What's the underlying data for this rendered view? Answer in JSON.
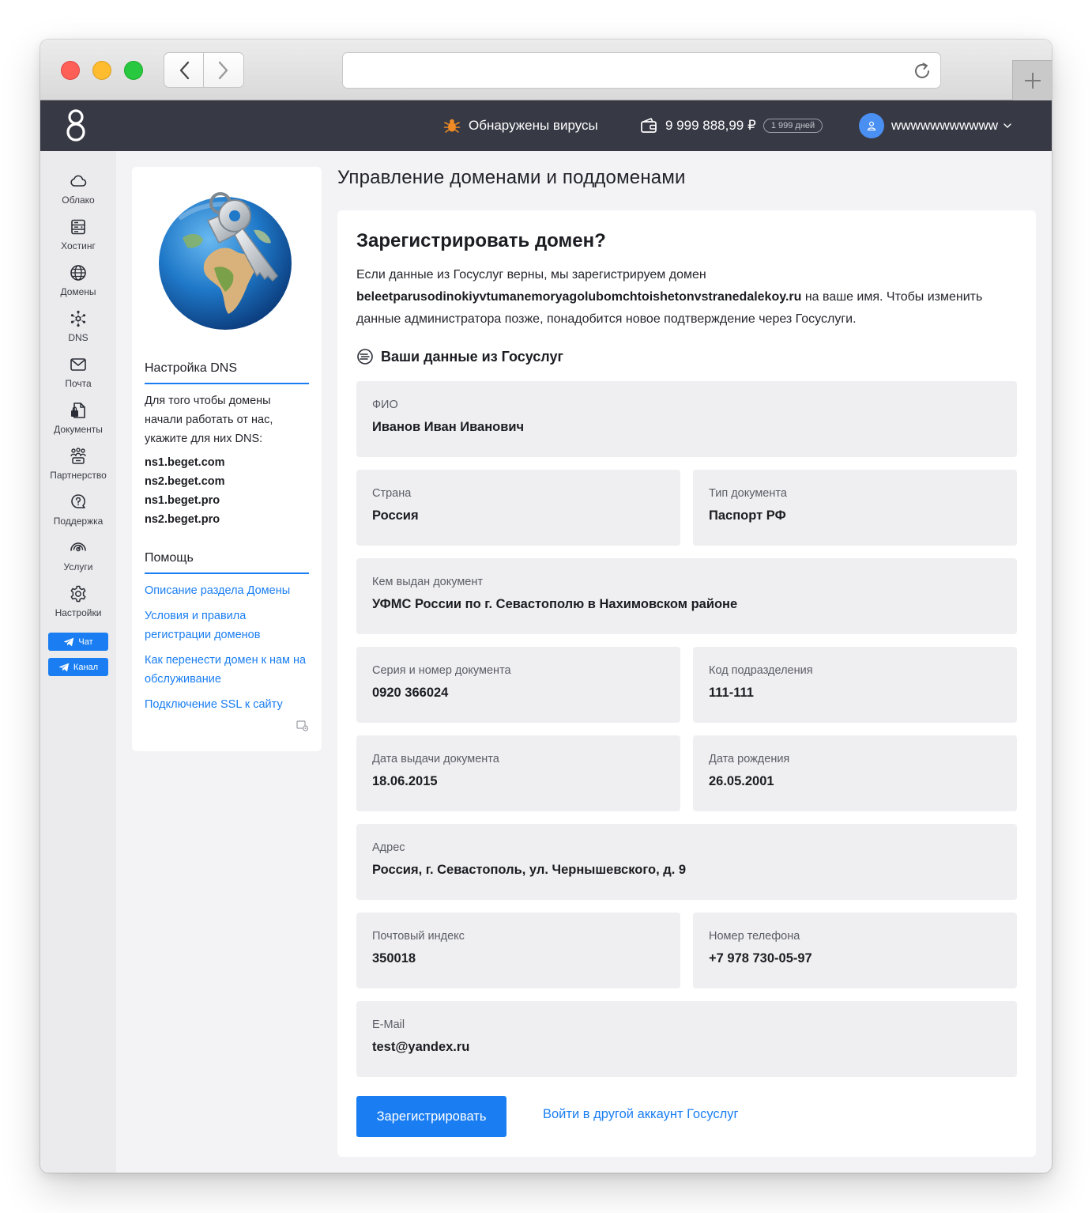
{
  "header": {
    "virus_text": "Обнаружены вирусы",
    "balance": "9 999 888,99 ₽",
    "days": "1 999 дней",
    "username": "wwwwwwwwwww"
  },
  "nav": {
    "items": [
      {
        "label": "Облако",
        "icon": "cloud-icon"
      },
      {
        "label": "Хостинг",
        "icon": "server-icon"
      },
      {
        "label": "Домены",
        "icon": "globe-icon"
      },
      {
        "label": "DNS",
        "icon": "dns-network-icon"
      },
      {
        "label": "Почта",
        "icon": "mail-icon"
      },
      {
        "label": "Документы",
        "icon": "documents-icon"
      },
      {
        "label": "Партнерство",
        "icon": "partners-icon"
      },
      {
        "label": "Поддержка",
        "icon": "support-icon"
      },
      {
        "label": "Услуги",
        "icon": "services-icon"
      },
      {
        "label": "Настройки",
        "icon": "gear-icon"
      }
    ],
    "chat_label": "Чат",
    "channel_label": "Канал"
  },
  "sidebar": {
    "dns_heading": "Настройка DNS",
    "dns_text": "Для того чтобы домены начали работать от нас, укажите для них DNS:",
    "nameservers": [
      "ns1.beget.com",
      "ns2.beget.com",
      "ns1.beget.pro",
      "ns2.beget.pro"
    ],
    "help_heading": "Помощь",
    "help_links": [
      "Описание раздела Домены",
      "Условия и правила регистрации доменов",
      "Как перенести домен к нам на обслуживание",
      "Подключение SSL к сайту"
    ]
  },
  "page": {
    "title": "Управление доменами и поддоменами"
  },
  "card": {
    "title": "Зарегистрировать домен?",
    "desc_prefix": "Если данные из Госуслуг верны, мы зарегистрируем домен",
    "domain": "beleetparusodinokiyvtumanemoryagolubomchtoishetonvstranedalekoy.ru",
    "desc_suffix": "на ваше имя. Чтобы изменить данные администратора позже, понадобится новое подтверждение через Госуслуги.",
    "subheading": "Ваши данные из Госуслуг",
    "fields": {
      "fio": {
        "label": "ФИО",
        "value": "Иванов Иван Иванович"
      },
      "country": {
        "label": "Страна",
        "value": "Россия"
      },
      "doc_type": {
        "label": "Тип документа",
        "value": "Паспорт РФ"
      },
      "issued_by": {
        "label": "Кем выдан документ",
        "value": "УФМС России по г. Севастополю в Нахимовском районе"
      },
      "doc_number": {
        "label": "Серия и номер документа",
        "value": "0920 366024"
      },
      "dept_code": {
        "label": "Код подразделения",
        "value": "111-111"
      },
      "issue_date": {
        "label": "Дата выдачи документа",
        "value": "18.06.2015"
      },
      "birth_date": {
        "label": "Дата рождения",
        "value": "26.05.2001"
      },
      "address": {
        "label": "Адрес",
        "value": "Россия, г. Севастополь, ул. Чернышевского, д. 9"
      },
      "postcode": {
        "label": "Почтовый индекс",
        "value": "350018"
      },
      "phone": {
        "label": "Номер телефона",
        "value": "+7 978 730-05-97"
      },
      "email": {
        "label": "E-Mail",
        "value": "test@yandex.ru"
      }
    },
    "register_button": "Зарегистрировать",
    "other_account_link": "Войти в другой аккаунт Госуслуг"
  },
  "colors": {
    "accent": "#1a7ef2",
    "topbar": "#373945",
    "field_bg": "#efeff1",
    "virus_icon": "#f08a24"
  }
}
